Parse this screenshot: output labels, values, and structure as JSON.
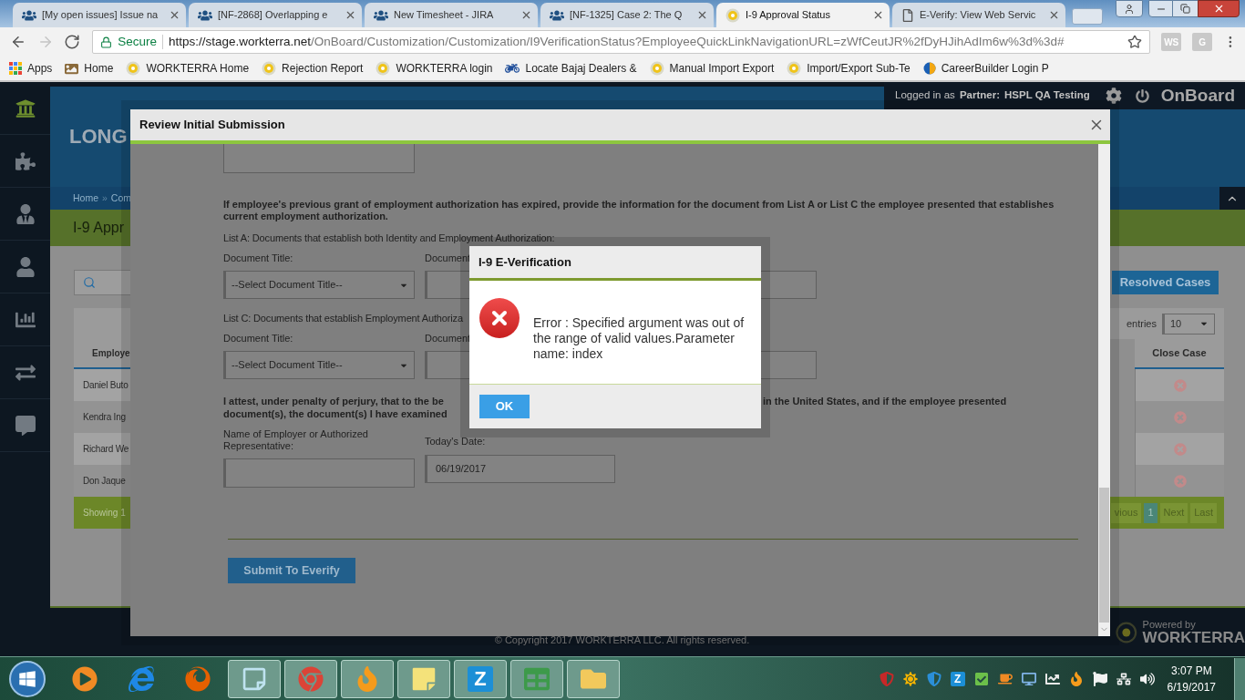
{
  "browser": {
    "tabs": [
      {
        "kind": "jira",
        "title": "[My open issues] Issue na",
        "selected": false
      },
      {
        "kind": "jira",
        "title": "[NF-2868] Overlapping e",
        "selected": false
      },
      {
        "kind": "jira",
        "title": "New Timesheet - JIRA",
        "selected": false
      },
      {
        "kind": "jira",
        "title": "[NF-1325] Case 2: The Q",
        "selected": false
      },
      {
        "kind": "badge",
        "title": "I-9 Approval Status",
        "selected": true
      },
      {
        "kind": "document",
        "title": "E-Verify: View Web Servic",
        "selected": false
      }
    ],
    "nav_buttons": [
      {
        "kind": "back",
        "disabled": false
      },
      {
        "kind": "forward",
        "disabled": true
      },
      {
        "kind": "reload",
        "disabled": false
      }
    ],
    "address": {
      "secure_label": "Secure",
      "url_host": "https://stage.workterra.net",
      "url_path": "/OnBoard/Customization/Customization/I9VerificationStatus?EmployeeQuickLinkNavigationURL=zWfCeutJR%2fDyHJihAdIm6w%3d%3d#"
    },
    "extensions": [
      "WS",
      "G"
    ],
    "bookmarks": [
      {
        "kind": "apps",
        "label": "Apps"
      },
      {
        "kind": "image",
        "label": "Home"
      },
      {
        "kind": "badge",
        "label": "WORKTERRA Home"
      },
      {
        "kind": "badge",
        "label": "Rejection Report"
      },
      {
        "kind": "badge",
        "label": "WORKTERRA login"
      },
      {
        "kind": "logo",
        "label": "Locate Bajaj Dealers &"
      },
      {
        "kind": "badge",
        "label": "Manual Import Export"
      },
      {
        "kind": "badge",
        "label": "Import/Export Sub-Te"
      },
      {
        "kind": "cb",
        "label": "CareerBuilder Login P"
      }
    ]
  },
  "app": {
    "sidebar": [
      {
        "kind": "home",
        "selected": true
      },
      {
        "kind": "puzzle",
        "selected": false
      },
      {
        "kind": "user-tie",
        "selected": false
      },
      {
        "kind": "user",
        "selected": false
      },
      {
        "kind": "chart",
        "selected": false
      },
      {
        "kind": "exchange",
        "selected": false
      },
      {
        "kind": "chat",
        "selected": false
      }
    ],
    "top_bar": {
      "logged_in_label": "Logged in as",
      "partner_label": "Partner:",
      "partner_name": "HSPL QA Testing",
      "product": "OnBoard"
    },
    "logo_text": "LONG",
    "breadcrumb": [
      "Home",
      "Com"
    ],
    "breadcrumb_separator": "»",
    "page_title": "I-9 Appr",
    "resolved_cases_button": "Resolved Cases",
    "entries_label": "entries",
    "entries_select": "10",
    "table": {
      "columns": [
        "Employe",
        "Close Case"
      ],
      "rows": [
        {
          "name": "Daniel Buto"
        },
        {
          "name": "Kendra Ing"
        },
        {
          "name": "Richard We"
        },
        {
          "name": "Don Jaque"
        }
      ]
    },
    "showing": "Showing 1",
    "pagination": [
      {
        "label": "vious",
        "selected": false
      },
      {
        "label": "1",
        "selected": true
      },
      {
        "label": "Next",
        "selected": false
      },
      {
        "label": "Last",
        "selected": false
      }
    ],
    "copyright": "© Copyright 2017 WORKTERRA LLC. All rights reserved.",
    "powered_by": "Powered by",
    "brand": "WORKTERRA"
  },
  "modal": {
    "title": "Review Initial Submission",
    "instruction": "If employee's previous grant of employment authorization has expired, provide the information for the document from List A or List C the employee presented that establishes current employment authorization.",
    "list_a_label": "List A: Documents that establish both Identity and Employment Authorization:",
    "list_c_label": "List C: Documents that establish Employment Authoriza",
    "document_groups": [
      {
        "title_label": "Document Title:",
        "select_value": "--Select Document Title--",
        "column_2_label": "Document"
      },
      {
        "title_label": "Document Title:",
        "select_value": "--Select Document Title--",
        "column_2_label": "Document"
      }
    ],
    "attestation_parts": [
      "I attest, under penalty of perjury, that to the be",
      "document(s), the document(s) I have examined",
      "in the United States, and if the employee presented"
    ],
    "employer_label": "Name of Employer or Authorized Representative:",
    "date_label": "Today's Date:",
    "date_value": "06/19/2017",
    "submit_button": "Submit To Everify"
  },
  "dialog": {
    "title": "I-9 E-Verification",
    "message": "Error : Specified argument was out of the range of valid values.Parameter name: index",
    "ok_button": "OK"
  },
  "taskbar": {
    "apps": [
      {
        "kind": "media",
        "running": false
      },
      {
        "kind": "ie",
        "running": false
      },
      {
        "kind": "firefox",
        "running": false
      },
      {
        "kind": "notepad",
        "running": true
      },
      {
        "kind": "chrome",
        "running": true
      },
      {
        "kind": "flame",
        "running": true
      },
      {
        "kind": "notes",
        "running": true
      },
      {
        "kind": "letter",
        "glyph": "Z",
        "running": true
      },
      {
        "kind": "sheet",
        "running": true
      },
      {
        "kind": "folder",
        "running": true
      }
    ],
    "tray": [
      {
        "kind": "shield-red"
      },
      {
        "kind": "sun"
      },
      {
        "kind": "shield-blue"
      },
      {
        "kind": "letter",
        "glyph": "Z"
      },
      {
        "kind": "check"
      },
      {
        "kind": "coffee"
      },
      {
        "kind": "monitor"
      },
      {
        "kind": "chart"
      },
      {
        "kind": "flame"
      },
      {
        "kind": "flag"
      },
      {
        "kind": "network"
      },
      {
        "kind": "speaker"
      }
    ],
    "clock_time": "3:07 PM",
    "clock_date": "6/19/2017"
  }
}
